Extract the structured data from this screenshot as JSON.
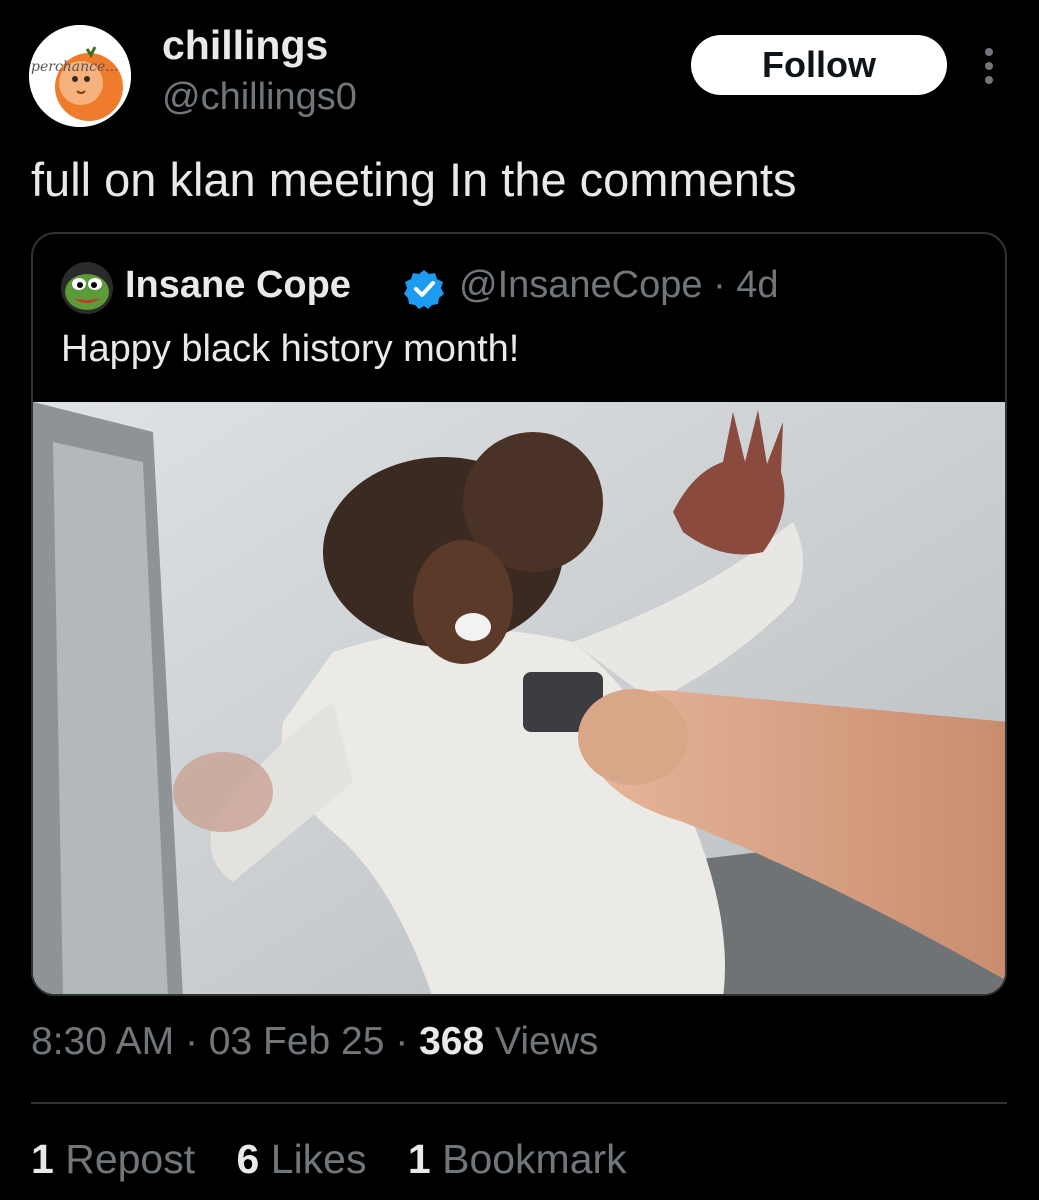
{
  "post": {
    "author": {
      "display_name": "chillings",
      "handle": "@chillings0",
      "avatar_text": "perchance..."
    },
    "follow_label": "Follow",
    "more_icon": "more-vertical-icon",
    "text": "full on klan meeting In the comments",
    "timestamp": "8:30 AM",
    "date": "03 Feb 25",
    "views_count": "368",
    "views_label": "Views",
    "separator": "·"
  },
  "quoted_post": {
    "display_name": "Insane Cope",
    "verified_icon": "verified-badge-icon",
    "handle": "@InsaneCope",
    "age": "4d",
    "text": "Happy black history month!",
    "media_icon": "photo-media"
  },
  "stats": {
    "reposts_count": "1",
    "reposts_label": "Repost",
    "likes_count": "6",
    "likes_label": "Likes",
    "bookmarks_count": "1",
    "bookmarks_label": "Bookmark"
  },
  "colors": {
    "background": "#000000",
    "primary_text": "#e7e9ea",
    "secondary_text": "#71767b",
    "border": "#2f3336",
    "verified": "#1d9bf0"
  }
}
